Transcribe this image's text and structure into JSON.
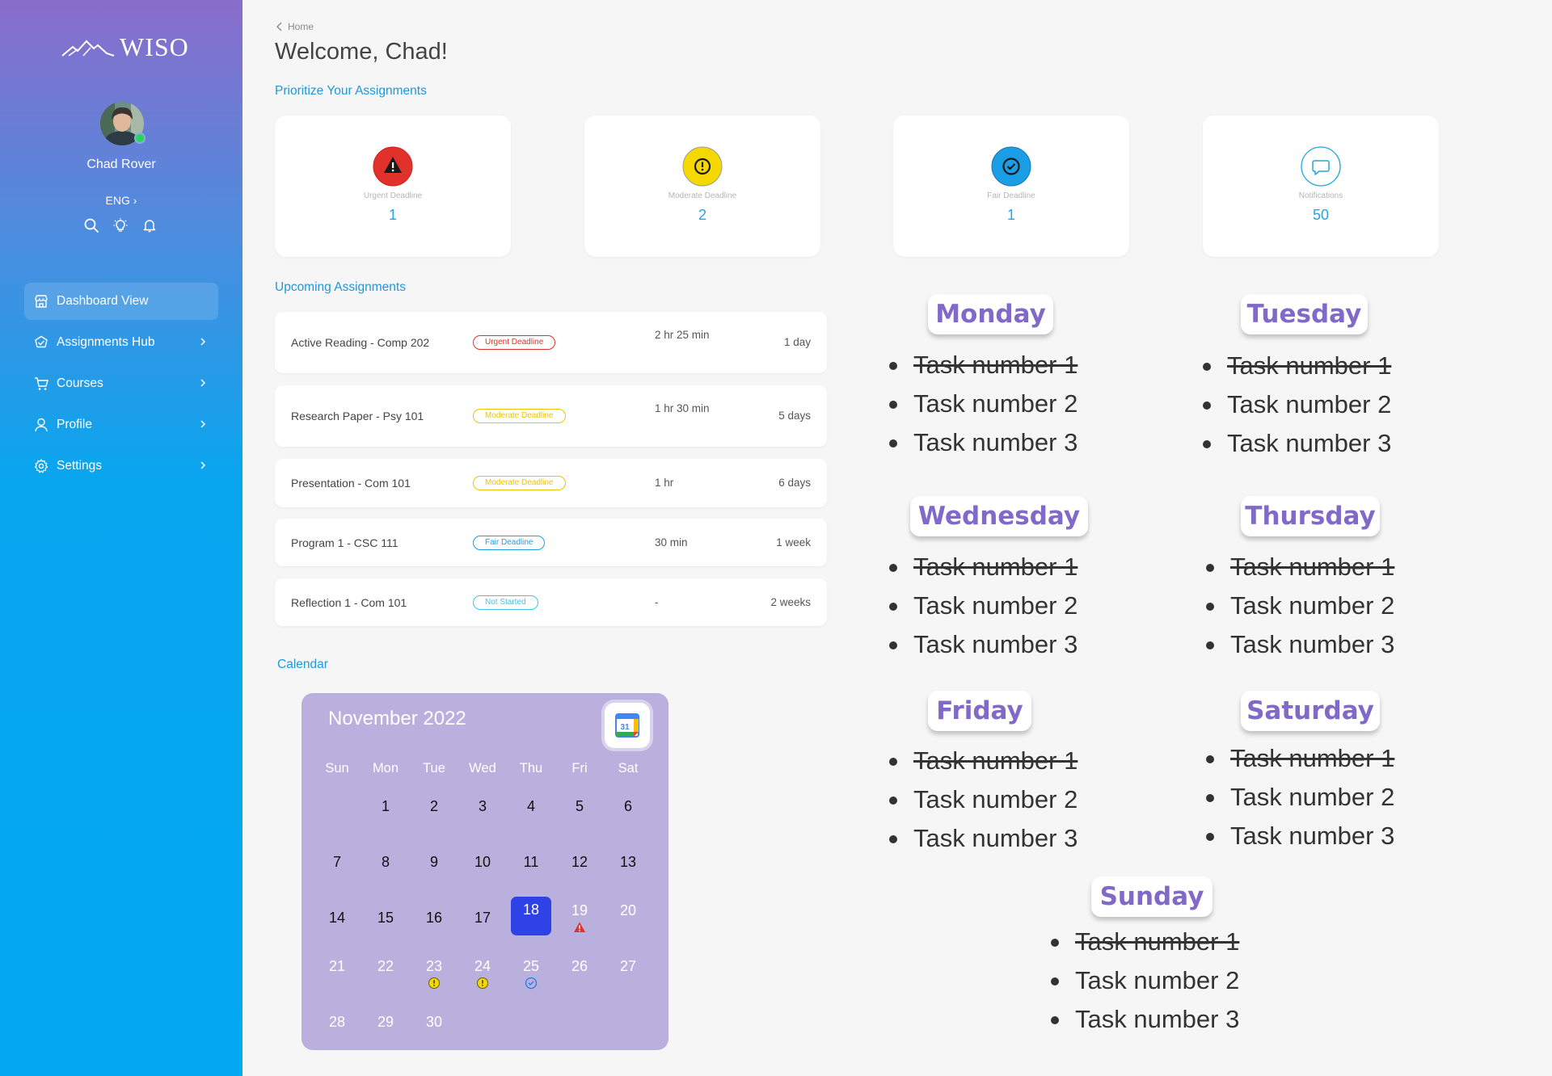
{
  "sidebar": {
    "logo": "WISO",
    "user_name": "Chad Rover",
    "language": "ENG ›",
    "nav": [
      {
        "label": "Dashboard View"
      },
      {
        "label": "Assignments Hub"
      },
      {
        "label": "Courses"
      },
      {
        "label": "Profile"
      },
      {
        "label": "Settings"
      }
    ]
  },
  "header": {
    "breadcrumb": "Home",
    "welcome": "Welcome, Chad!"
  },
  "priority": {
    "title": "Prioritize Your Assignments",
    "cards": [
      {
        "label": "Urgent Deadline",
        "value": "1",
        "color": "#e0322b"
      },
      {
        "label": "Moderate Deadline",
        "value": "2",
        "color": "#f5d800"
      },
      {
        "label": "Fair Deadline",
        "value": "1",
        "color": "#1c9ee6"
      },
      {
        "label": "Notifications",
        "value": "50",
        "color": "#24a5df"
      }
    ]
  },
  "upcoming": {
    "title": "Upcoming Assignments",
    "rows": [
      {
        "name": "Active Reading - Comp 202",
        "badge": "Urgent Deadline",
        "badge_color": "#e0322b",
        "time": "2 hr 25 min",
        "due": "1 day"
      },
      {
        "name": "Research Paper - Psy 101",
        "badge": "Moderate Deadline",
        "badge_color": "#f0c300",
        "time": "1 hr 30 min",
        "due": "5 days"
      },
      {
        "name": "Presentation - Com 101",
        "badge": "Moderate Deadline",
        "badge_color": "#f0c300",
        "time": "1 hr",
        "due": "6 days"
      },
      {
        "name": "Program 1 - CSC 111",
        "badge": "Fair Deadline",
        "badge_color": "#1c9ee6",
        "time": "30 min",
        "due": "1 week"
      },
      {
        "name": "Reflection 1 - Com 101",
        "badge": "Not Started",
        "badge_color": "#3cc6ee",
        "time": "-",
        "due": "2 weeks"
      }
    ]
  },
  "calendar": {
    "section_title": "Calendar",
    "month": "November 2022",
    "gcal_day": "31",
    "weekdays": [
      "Sun",
      "Mon",
      "Tue",
      "Wed",
      "Thu",
      "Fri",
      "Sat"
    ],
    "today": "18",
    "days": [
      {
        "d": "1",
        "col": 1,
        "row": 0,
        "tone": "dark"
      },
      {
        "d": "2",
        "col": 2,
        "row": 0,
        "tone": "dark"
      },
      {
        "d": "3",
        "col": 3,
        "row": 0,
        "tone": "dark"
      },
      {
        "d": "4",
        "col": 4,
        "row": 0,
        "tone": "dark"
      },
      {
        "d": "5",
        "col": 5,
        "row": 0,
        "tone": "dark"
      },
      {
        "d": "6",
        "col": 6,
        "row": 0,
        "tone": "dark"
      },
      {
        "d": "7",
        "col": 0,
        "row": 1,
        "tone": "dark"
      },
      {
        "d": "8",
        "col": 1,
        "row": 1,
        "tone": "dark"
      },
      {
        "d": "9",
        "col": 2,
        "row": 1,
        "tone": "dark"
      },
      {
        "d": "10",
        "col": 3,
        "row": 1,
        "tone": "dark"
      },
      {
        "d": "11",
        "col": 4,
        "row": 1,
        "tone": "dark"
      },
      {
        "d": "12",
        "col": 5,
        "row": 1,
        "tone": "dark"
      },
      {
        "d": "13",
        "col": 6,
        "row": 1,
        "tone": "dark"
      },
      {
        "d": "14",
        "col": 0,
        "row": 2,
        "tone": "dark"
      },
      {
        "d": "15",
        "col": 1,
        "row": 2,
        "tone": "dark"
      },
      {
        "d": "16",
        "col": 2,
        "row": 2,
        "tone": "dark"
      },
      {
        "d": "17",
        "col": 3,
        "row": 2,
        "tone": "dark"
      },
      {
        "d": "18",
        "col": 4,
        "row": 2,
        "tone": "today"
      },
      {
        "d": "19",
        "col": 5,
        "row": 2,
        "tone": "light",
        "marker": "urgent"
      },
      {
        "d": "20",
        "col": 6,
        "row": 2,
        "tone": "light"
      },
      {
        "d": "21",
        "col": 0,
        "row": 3,
        "tone": "light"
      },
      {
        "d": "22",
        "col": 1,
        "row": 3,
        "tone": "light"
      },
      {
        "d": "23",
        "col": 2,
        "row": 3,
        "tone": "light",
        "marker": "moderate"
      },
      {
        "d": "24",
        "col": 3,
        "row": 3,
        "tone": "light",
        "marker": "moderate"
      },
      {
        "d": "25",
        "col": 4,
        "row": 3,
        "tone": "light",
        "marker": "fair"
      },
      {
        "d": "26",
        "col": 5,
        "row": 3,
        "tone": "light"
      },
      {
        "d": "27",
        "col": 6,
        "row": 3,
        "tone": "light"
      },
      {
        "d": "28",
        "col": 0,
        "row": 4,
        "tone": "light"
      },
      {
        "d": "29",
        "col": 1,
        "row": 4,
        "tone": "light"
      },
      {
        "d": "30",
        "col": 2,
        "row": 4,
        "tone": "light"
      }
    ]
  },
  "week": [
    {
      "day": "Monday",
      "tasks": [
        {
          "text": "Task number 1",
          "done": true
        },
        {
          "text": "Task number 2",
          "done": false
        },
        {
          "text": "Task number 3",
          "done": false
        }
      ]
    },
    {
      "day": "Tuesday",
      "tasks": [
        {
          "text": "Task number 1",
          "done": true
        },
        {
          "text": "Task number 2",
          "done": false
        },
        {
          "text": "Task number 3",
          "done": false
        }
      ]
    },
    {
      "day": "Wednesday",
      "tasks": [
        {
          "text": "Task number 1",
          "done": true
        },
        {
          "text": "Task number 2",
          "done": false
        },
        {
          "text": "Task number 3",
          "done": false
        }
      ]
    },
    {
      "day": "Thursday",
      "tasks": [
        {
          "text": "Task number 1",
          "done": true
        },
        {
          "text": "Task number 2",
          "done": false
        },
        {
          "text": "Task number 3",
          "done": false
        }
      ]
    },
    {
      "day": "Friday",
      "tasks": [
        {
          "text": "Task number 1",
          "done": true
        },
        {
          "text": "Task number 2",
          "done": false
        },
        {
          "text": "Task number 3",
          "done": false
        }
      ]
    },
    {
      "day": "Saturday",
      "tasks": [
        {
          "text": "Task number 1",
          "done": true
        },
        {
          "text": "Task number 2",
          "done": false
        },
        {
          "text": "Task number 3",
          "done": false
        }
      ]
    },
    {
      "day": "Sunday",
      "tasks": [
        {
          "text": "Task number 1",
          "done": true
        },
        {
          "text": "Task number 2",
          "done": false
        },
        {
          "text": "Task number 3",
          "done": false
        }
      ]
    }
  ],
  "icons": {
    "logo": "mountain-logo-icon",
    "search": "search-icon",
    "idea": "lightbulb-icon",
    "bell": "bell-icon",
    "dashboard": "store-icon",
    "hub": "hub-icon",
    "courses": "cart-icon",
    "profile": "user-icon",
    "settings": "gear-icon"
  }
}
